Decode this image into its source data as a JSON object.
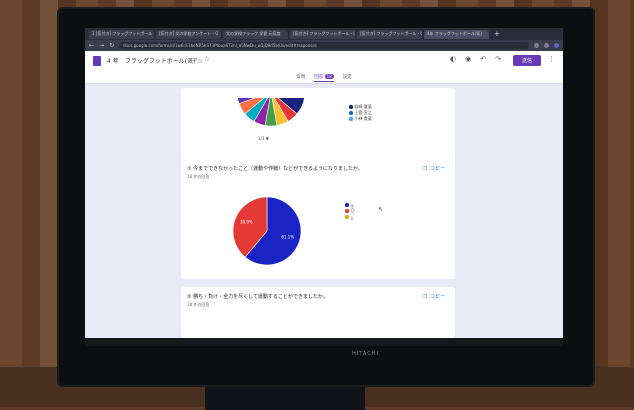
{
  "browser": {
    "tabs": [
      {
        "label": "1 [気付き] フラッグフットボール - G"
      },
      {
        "label": "[気付き] 文の学校アンケート - G"
      },
      {
        "label": "文の学校フラッグ 学習 元気度"
      },
      {
        "label": "[気付き] フラッグフットボール - G"
      },
      {
        "label": "[気付き] フラッグフットボール - G"
      },
      {
        "label": "4年 フラッグフットボール(気)"
      }
    ],
    "url": "docs.google.com/forms/d/1w6cE1beNR5hS73Ptbua6T2nl_a5NwDu_w5jQ9d5blUk/edit#responses"
  },
  "form": {
    "title": "4 年　フラッグフットボール(気) ☆",
    "send_label": "送信",
    "tabs": [
      "質問",
      "回答",
      "設定"
    ],
    "response_count": "18"
  },
  "cards": [
    {
      "legend": [
        {
          "label": "岩崎 夏斐",
          "color": "#1a237e"
        },
        {
          "label": "上野 宣之",
          "color": "#1565c0"
        },
        {
          "label": "小林 貴斐",
          "color": "#42a5f5"
        }
      ],
      "pager": "1/3 ▼",
      "chart_data": {
        "type": "pie",
        "title": "",
        "categories": [],
        "values": [
          2,
          1,
          1,
          1,
          1,
          1,
          1,
          1,
          1,
          1,
          1,
          1,
          1,
          1,
          1,
          1,
          1
        ],
        "colors": [
          "#1a237e",
          "#e53935",
          "#fbc02d",
          "#43a047",
          "#8e24aa",
          "#00acc1",
          "#ff7043",
          "#5e35b1",
          "#7cb342",
          "#f06292",
          "#3949ab",
          "#00897b",
          "#c0ca33",
          "#6d4c41",
          "#d81b60",
          "#26a69a",
          "#fb8c00"
        ]
      }
    },
    {
      "question": "① 今までできなかったこと（運動や作戦）などができるようになりましたか。",
      "count": "18 件の回答",
      "copy_label": "コピー",
      "legend": [
        {
          "label": "◎",
          "color": "#1a23c4"
        },
        {
          "label": "〇",
          "color": "#e53935"
        },
        {
          "label": "△",
          "color": "#f4a300"
        }
      ],
      "chart_data": {
        "type": "pie",
        "title": "",
        "categories": [
          "◎",
          "〇"
        ],
        "values": [
          61.1,
          38.9
        ],
        "value_labels": [
          "61.1%",
          "38.9%"
        ],
        "colors": [
          "#1a23c4",
          "#e53935"
        ]
      }
    },
    {
      "question": "② 勝ち・負け・全力を尽くして運動することができましたか。",
      "count": "18 件の回答",
      "copy_label": "コピー"
    }
  ],
  "tv_brand": "HITACHI"
}
